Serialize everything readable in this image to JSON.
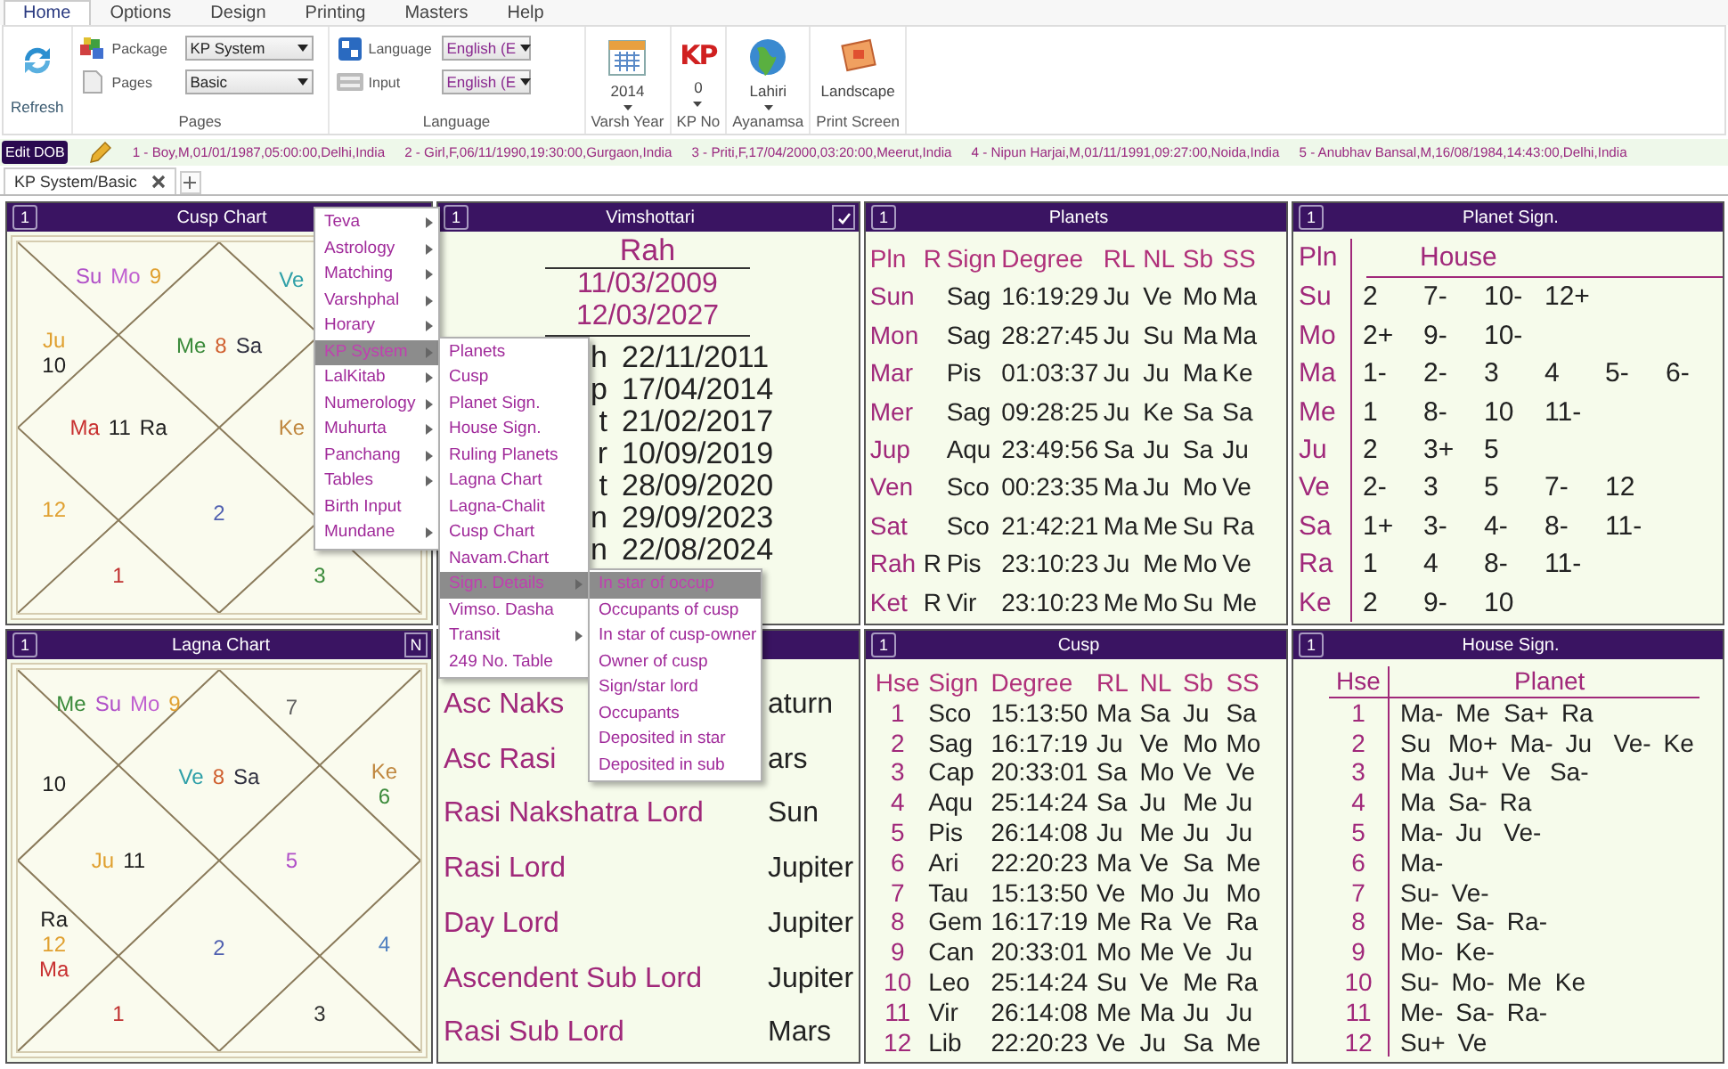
{
  "ribbon": {
    "tabs": [
      {
        "label": "Home",
        "selected": true
      },
      {
        "label": "Options",
        "selected": false
      },
      {
        "label": "Design",
        "selected": false
      },
      {
        "label": "Printing",
        "selected": false
      },
      {
        "label": "Masters",
        "selected": false
      },
      {
        "label": "Help",
        "selected": false
      }
    ],
    "refresh": {
      "label": "Refresh"
    },
    "field_groups": [
      {
        "label": "Pages",
        "fields": [
          {
            "kind": "package",
            "label": "Package",
            "value": "KP System"
          },
          {
            "kind": "pages",
            "label": "Pages",
            "value": "Basic"
          }
        ]
      },
      {
        "label": "Language",
        "fields": [
          {
            "kind": "language",
            "label": "Language",
            "value": "English (E"
          },
          {
            "kind": "input",
            "label": "Input",
            "value": "English (E"
          }
        ]
      }
    ],
    "big_buttons": [
      {
        "kind": "calendar",
        "value": "2014",
        "dropdown": true,
        "label": "Varsh Year"
      },
      {
        "kind": "kp",
        "icon_text": "KP",
        "value": "0",
        "dropdown": true,
        "label": "KP No"
      },
      {
        "kind": "globe",
        "value": "Lahiri",
        "dropdown": true,
        "label": "Ayanamsa"
      },
      {
        "kind": "print",
        "value": "Landscape",
        "dropdown": false,
        "label": "Print Screen"
      }
    ]
  },
  "dob_bar": {
    "button": "Edit DOB",
    "entries": [
      "1 - Boy,M,01/01/1987,05:00:00,Delhi,India",
      "2 - Girl,F,06/11/1990,19:30:00,Gurgaon,India",
      "3 - Priti,F,17/04/2000,03:20:00,Meerut,India",
      "4 - Nipun Harjai,M,01/11/1991,09:27:00,Noida,India",
      "5 - Anubhav Bansal,M,16/08/1984,14:43:00,Delhi,India"
    ]
  },
  "doc_tabs": [
    {
      "label": "KP System/Basic",
      "selected": true
    }
  ],
  "panels": [
    {
      "kind": "chart",
      "number": "1",
      "title": "Cusp Chart",
      "houses": {
        "house_2": {
          "items": [
            {
              "text": "Su",
              "color": "#b050c8"
            },
            {
              "text": "Mo",
              "color": "#c060d0"
            },
            {
              "text": "9",
              "color": "#e0a030"
            }
          ]
        },
        "house_12": {
          "items": [
            {
              "text": "Ve",
              "color": "#30a0a8"
            }
          ]
        },
        "house_3": {
          "items": [
            {
              "text": "Ju",
              "color": "#e0a030"
            },
            {
              "text": "10",
              "color": "#202020"
            }
          ]
        },
        "house_1": {
          "items": [
            {
              "text": "Me",
              "color": "#3a8a3a"
            },
            {
              "text": "8",
              "color": "#d06030"
            },
            {
              "text": "Sa",
              "color": "#303040"
            }
          ]
        },
        "house_4": {
          "items": [
            {
              "text": "Ma",
              "color": "#c83030"
            },
            {
              "text": "11",
              "color": "#202020"
            },
            {
              "text": "Ra",
              "color": "#202020"
            }
          ]
        },
        "house_10": {
          "items": [
            {
              "text": "Ke",
              "color": "#c08840"
            }
          ]
        },
        "house_5": {
          "items": [
            {
              "text": "12",
              "color": "#e0a030"
            }
          ]
        },
        "house_7": {
          "items": [
            {
              "text": "2",
              "color": "#5060b0"
            }
          ]
        },
        "house_6": {
          "items": [
            {
              "text": "1",
              "color": "#c03030"
            }
          ]
        },
        "house_8": {
          "items": [
            {
              "text": "3",
              "color": "#3a8a3a"
            }
          ]
        }
      }
    },
    {
      "kind": "dasha",
      "number": "1",
      "title": "Vimshottari",
      "corner": {
        "kind": "check"
      },
      "lord": "Rah",
      "start": "11/03/2009",
      "end": "12/03/2027",
      "rows": [
        {
          "lord": "h",
          "date": "22/11/2011"
        },
        {
          "lord": "p",
          "date": "17/04/2014"
        },
        {
          "lord": "t",
          "date": "21/02/2017"
        },
        {
          "lord": "r",
          "date": "10/09/2019"
        },
        {
          "lord": "t",
          "date": "28/09/2020"
        },
        {
          "lord": "n",
          "date": "29/09/2023"
        },
        {
          "lord": "n",
          "date": "22/08/2024"
        }
      ]
    },
    {
      "kind": "planets_table",
      "number": "1",
      "title": "Planets",
      "columns": [
        "Pln",
        "R",
        "Sign",
        "Degree",
        "RL",
        "NL",
        "Sb",
        "SS"
      ],
      "rows": [
        {
          "planet": "Sun",
          "sign": "Sag",
          "degree": "16:19:29",
          "rl": "Ju",
          "nl": "Ve",
          "sb": "Mo",
          "ss": "Ma"
        },
        {
          "planet": "Mon",
          "sign": "Sag",
          "degree": "28:27:45",
          "rl": "Ju",
          "nl": "Su",
          "sb": "Ma",
          "ss": "Ma"
        },
        {
          "planet": "Mar",
          "sign": "Pis",
          "degree": "01:03:37",
          "rl": "Ju",
          "nl": "Ju",
          "sb": "Ma",
          "ss": "Ke"
        },
        {
          "planet": "Mer",
          "sign": "Sag",
          "degree": "09:28:25",
          "rl": "Ju",
          "nl": "Ke",
          "sb": "Sa",
          "ss": "Sa"
        },
        {
          "planet": "Jup",
          "sign": "Aqu",
          "degree": "23:49:56",
          "rl": "Sa",
          "nl": "Ju",
          "sb": "Sa",
          "ss": "Ju"
        },
        {
          "planet": "Ven",
          "sign": "Sco",
          "degree": "00:23:35",
          "rl": "Ma",
          "nl": "Ju",
          "sb": "Mo",
          "ss": "Ve"
        },
        {
          "planet": "Sat",
          "sign": "Sco",
          "degree": "21:42:21",
          "rl": "Ma",
          "nl": "Me",
          "sb": "Su",
          "ss": "Ra"
        },
        {
          "planet": "Rah",
          "retro": "R",
          "sign": "Pis",
          "degree": "23:10:23",
          "rl": "Ju",
          "nl": "Me",
          "sb": "Mo",
          "ss": "Ve"
        },
        {
          "planet": "Ket",
          "retro": "R",
          "sign": "Vir",
          "degree": "23:10:23",
          "rl": "Me",
          "nl": "Mo",
          "sb": "Su",
          "ss": "Me"
        }
      ]
    },
    {
      "kind": "planet_sign",
      "number": "1",
      "title": "Planet Sign.",
      "columns": [
        "Pln",
        "House"
      ],
      "rows": [
        {
          "planet": "Su",
          "houses": [
            "2",
            "7-",
            "10-",
            "12+"
          ]
        },
        {
          "planet": "Mo",
          "houses": [
            "2+",
            "9-",
            "10-"
          ]
        },
        {
          "planet": "Ma",
          "houses": [
            "1-",
            "2-",
            "3",
            "4",
            "5-",
            "6-"
          ]
        },
        {
          "planet": "Me",
          "houses": [
            "1",
            "8-",
            "10",
            "11-"
          ]
        },
        {
          "planet": "Ju",
          "houses": [
            "2",
            "3+",
            "5"
          ]
        },
        {
          "planet": "Ve",
          "houses": [
            "2-",
            "3",
            "5",
            "7-",
            "12"
          ]
        },
        {
          "planet": "Sa",
          "houses": [
            "1+",
            "3-",
            "4-",
            "8-",
            "11-"
          ]
        },
        {
          "planet": "Ra",
          "houses": [
            "1",
            "4",
            "8-",
            "11-"
          ]
        },
        {
          "planet": "Ke",
          "houses": [
            "2",
            "9-",
            "10"
          ]
        }
      ]
    },
    {
      "kind": "chart",
      "number": "1",
      "title": "Lagna Chart",
      "corner": {
        "kind": "text",
        "text": "N"
      },
      "houses": {
        "house_2": {
          "items": [
            {
              "text": "Me",
              "color": "#3a8a3a"
            },
            {
              "text": "Su",
              "color": "#b050c8"
            },
            {
              "text": "Mo",
              "color": "#c060d0"
            },
            {
              "text": "9",
              "color": "#e0a030"
            }
          ]
        },
        "house_12": {
          "items": [
            {
              "text": "7",
              "color": "#606060"
            }
          ]
        },
        "house_11": {
          "items": [
            {
              "text": "Ke",
              "color": "#c08840"
            },
            {
              "text": "6",
              "color": "#3a8a3a"
            }
          ]
        },
        "house_3": {
          "items": [
            {
              "text": "10",
              "color": "#202020"
            }
          ]
        },
        "house_1": {
          "items": [
            {
              "text": "Ve",
              "color": "#30a0a8"
            },
            {
              "text": "8",
              "color": "#d06030"
            },
            {
              "text": "Sa",
              "color": "#303040"
            }
          ]
        },
        "house_4": {
          "items": [
            {
              "text": "Ju",
              "color": "#e0a030"
            },
            {
              "text": "11",
              "color": "#202020"
            }
          ]
        },
        "house_10": {
          "items": [
            {
              "text": "5",
              "color": "#b050c8"
            }
          ]
        },
        "house_5": {
          "items": [
            {
              "text": "Ra",
              "color": "#202020"
            },
            {
              "text": "12",
              "color": "#e0a030"
            },
            {
              "text": "Ma",
              "color": "#c83030"
            }
          ]
        },
        "house_7": {
          "items": [
            {
              "text": "2",
              "color": "#5060b0"
            }
          ]
        },
        "house_9": {
          "items": [
            {
              "text": "4",
              "color": "#5080c0"
            }
          ]
        },
        "house_6": {
          "items": [
            {
              "text": "1",
              "color": "#c03030"
            }
          ]
        },
        "house_8": {
          "items": [
            {
              "text": "3",
              "color": "#303030"
            }
          ]
        }
      }
    },
    {
      "kind": "lords",
      "rows": [
        {
          "label": "Asc Naks",
          "value": "aturn"
        },
        {
          "label": "Asc Rasi",
          "value": "ars"
        },
        {
          "label": "Rasi Nakshatra Lord",
          "value": "Sun"
        },
        {
          "label": "Rasi Lord",
          "value": "Jupiter"
        },
        {
          "label": "Day Lord",
          "value": "Jupiter"
        },
        {
          "label": "Ascendent Sub Lord",
          "value": "Jupiter"
        },
        {
          "label": "Rasi Sub Lord",
          "value": "Mars"
        }
      ]
    },
    {
      "kind": "cusp_table",
      "number": "1",
      "title": "Cusp",
      "columns": [
        "Hse",
        "Sign",
        "Degree",
        "RL",
        "NL",
        "Sb",
        "SS"
      ],
      "rows": [
        {
          "house": "1",
          "sign": "Sco",
          "degree": "15:13:50",
          "rl": "Ma",
          "nl": "Sa",
          "sb": "Ju",
          "ss": "Sa"
        },
        {
          "house": "2",
          "sign": "Sag",
          "degree": "16:17:19",
          "rl": "Ju",
          "nl": "Ve",
          "sb": "Mo",
          "ss": "Mo"
        },
        {
          "house": "3",
          "sign": "Cap",
          "degree": "20:33:01",
          "rl": "Sa",
          "nl": "Mo",
          "sb": "Ve",
          "ss": "Ve"
        },
        {
          "house": "4",
          "sign": "Aqu",
          "degree": "25:14:24",
          "rl": "Sa",
          "nl": "Ju",
          "sb": "Me",
          "ss": "Ju"
        },
        {
          "house": "5",
          "sign": "Pis",
          "degree": "26:14:08",
          "rl": "Ju",
          "nl": "Me",
          "sb": "Ju",
          "ss": "Ju"
        },
        {
          "house": "6",
          "sign": "Ari",
          "degree": "22:20:23",
          "rl": "Ma",
          "nl": "Ve",
          "sb": "Sa",
          "ss": "Me"
        },
        {
          "house": "7",
          "sign": "Tau",
          "degree": "15:13:50",
          "rl": "Ve",
          "nl": "Mo",
          "sb": "Ju",
          "ss": "Mo"
        },
        {
          "house": "8",
          "sign": "Gem",
          "degree": "16:17:19",
          "rl": "Me",
          "nl": "Ra",
          "sb": "Ve",
          "ss": "Ra"
        },
        {
          "house": "9",
          "sign": "Can",
          "degree": "20:33:01",
          "rl": "Mo",
          "nl": "Me",
          "sb": "Ve",
          "ss": "Ju"
        },
        {
          "house": "10",
          "sign": "Leo",
          "degree": "25:14:24",
          "rl": "Su",
          "nl": "Ve",
          "sb": "Me",
          "ss": "Ra"
        },
        {
          "house": "11",
          "sign": "Vir",
          "degree": "26:14:08",
          "rl": "Me",
          "nl": "Ma",
          "sb": "Ju",
          "ss": "Ju"
        },
        {
          "house": "12",
          "sign": "Lib",
          "degree": "22:20:23",
          "rl": "Ve",
          "nl": "Ju",
          "sb": "Sa",
          "ss": "Me"
        }
      ]
    },
    {
      "kind": "house_sign",
      "number": "1",
      "title": "House Sign.",
      "columns": [
        "Hse",
        "Planet"
      ],
      "rows": [
        {
          "house": "1",
          "planets": [
            "Ma-",
            "Me",
            "Sa+",
            "Ra"
          ]
        },
        {
          "house": "2",
          "planets": [
            "Su",
            "Mo+",
            "Ma-",
            "Ju",
            "Ve-",
            "Ke"
          ]
        },
        {
          "house": "3",
          "planets": [
            "Ma",
            "Ju+",
            "Ve",
            "Sa-"
          ]
        },
        {
          "house": "4",
          "planets": [
            "Ma",
            "Sa-",
            "Ra"
          ]
        },
        {
          "house": "5",
          "planets": [
            "Ma-",
            "Ju",
            "Ve-"
          ]
        },
        {
          "house": "6",
          "planets": [
            "Ma-"
          ]
        },
        {
          "house": "7",
          "planets": [
            "Su-",
            "Ve-"
          ]
        },
        {
          "house": "8",
          "planets": [
            "Me-",
            "Sa-",
            "Ra-"
          ]
        },
        {
          "house": "9",
          "planets": [
            "Mo-",
            "Ke-"
          ]
        },
        {
          "house": "10",
          "planets": [
            "Su-",
            "Mo-",
            "Me",
            "Ke"
          ]
        },
        {
          "house": "11",
          "planets": [
            "Me-",
            "Sa-",
            "Ra-"
          ]
        },
        {
          "house": "12",
          "planets": [
            "Su+",
            "Ve"
          ]
        }
      ]
    }
  ],
  "context_menu": {
    "items": [
      {
        "label": "Teva",
        "has_submenu": true,
        "selected": false
      },
      {
        "label": "Astrology",
        "has_submenu": true,
        "selected": false
      },
      {
        "label": "Matching",
        "has_submenu": true,
        "selected": false
      },
      {
        "label": "Varshphal",
        "has_submenu": true,
        "selected": false
      },
      {
        "label": "Horary",
        "has_submenu": true,
        "selected": false
      },
      {
        "label": "KP System",
        "has_submenu": true,
        "selected": true,
        "children": [
          {
            "label": "Planets",
            "has_submenu": false,
            "selected": false
          },
          {
            "label": "Cusp",
            "has_submenu": false,
            "selected": false
          },
          {
            "label": "Planet Sign.",
            "has_submenu": false,
            "selected": false
          },
          {
            "label": "House Sign.",
            "has_submenu": false,
            "selected": false
          },
          {
            "label": "Ruling Planets",
            "has_submenu": false,
            "selected": false
          },
          {
            "label": "Lagna Chart",
            "has_submenu": false,
            "selected": false
          },
          {
            "label": "Lagna-Chalit",
            "has_submenu": false,
            "selected": false
          },
          {
            "label": "Cusp Chart",
            "has_submenu": false,
            "selected": false
          },
          {
            "label": "Navam.Chart",
            "has_submenu": false,
            "selected": false
          },
          {
            "label": "Sign. Details",
            "has_submenu": true,
            "selected": true,
            "children": [
              {
                "label": "In star of occup",
                "has_submenu": false,
                "selected": true
              },
              {
                "label": "Occupants of cusp",
                "has_submenu": false,
                "selected": false
              },
              {
                "label": "In star of cusp-owner",
                "has_submenu": false,
                "selected": false
              },
              {
                "label": "Owner of cusp",
                "has_submenu": false,
                "selected": false
              },
              {
                "label": "Sign/star lord",
                "has_submenu": false,
                "selected": false
              },
              {
                "label": "Occupants",
                "has_submenu": false,
                "selected": false
              },
              {
                "label": "Deposited in star",
                "has_submenu": false,
                "selected": false
              },
              {
                "label": "Deposited in sub",
                "has_submenu": false,
                "selected": false
              }
            ]
          },
          {
            "label": "Vimso. Dasha",
            "has_submenu": false,
            "selected": false
          },
          {
            "label": "Transit",
            "has_submenu": true,
            "selected": false
          },
          {
            "label": "249 No. Table",
            "has_submenu": false,
            "selected": false
          }
        ]
      },
      {
        "label": "LalKitab",
        "has_submenu": true,
        "selected": false
      },
      {
        "label": "Numerology",
        "has_submenu": true,
        "selected": false
      },
      {
        "label": "Muhurta",
        "has_submenu": true,
        "selected": false
      },
      {
        "label": "Panchang",
        "has_submenu": true,
        "selected": false
      },
      {
        "label": "Tables",
        "has_submenu": true,
        "selected": false
      },
      {
        "label": "Birth Input",
        "has_submenu": false,
        "selected": false
      },
      {
        "label": "Mundane",
        "has_submenu": true,
        "selected": false
      }
    ]
  }
}
